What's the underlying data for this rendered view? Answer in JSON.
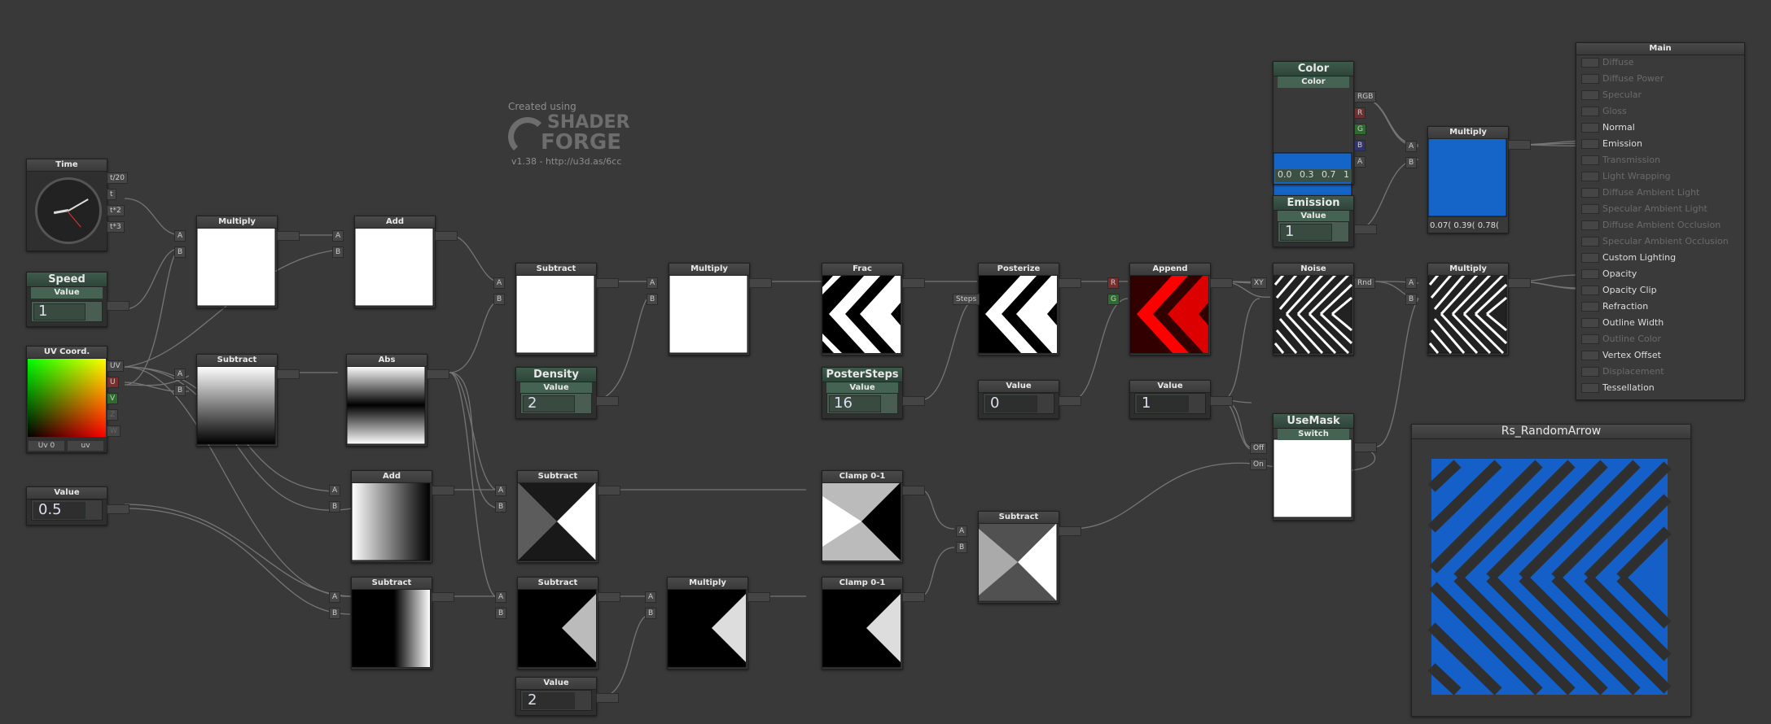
{
  "watermark": {
    "created": "Created using",
    "logo_line1": "SHADER",
    "logo_line2": "FORGE",
    "version": "v1.38 - http://u3d.as/6cc"
  },
  "nodes": {
    "time": {
      "title": "Time",
      "outs": [
        "t/20",
        "t",
        "t*2",
        "t*3"
      ]
    },
    "speed": {
      "title": "Speed",
      "sub": "Value",
      "value": "1"
    },
    "uv": {
      "title": "UV Coord.",
      "outs": [
        "UV",
        "U",
        "V",
        "Z",
        "W"
      ],
      "ch": "Uv 0",
      "mode": "uv"
    },
    "half": {
      "title": "Value",
      "value": "0.5"
    },
    "multiply1": {
      "title": "Multiply"
    },
    "add1": {
      "title": "Add"
    },
    "subtract1": {
      "title": "Subtract"
    },
    "abs": {
      "title": "Abs"
    },
    "subtract2": {
      "title": "Subtract"
    },
    "density": {
      "title": "Density",
      "sub": "Value",
      "value": "2"
    },
    "multiply2": {
      "title": "Multiply"
    },
    "frac": {
      "title": "Frac"
    },
    "postersteps": {
      "title": "PosterSteps",
      "sub": "Value",
      "value": "16"
    },
    "posterize": {
      "title": "Posterize",
      "steps": "Steps"
    },
    "value0": {
      "title": "Value",
      "value": "0"
    },
    "append": {
      "title": "Append",
      "r": "R",
      "g": "G"
    },
    "value1": {
      "title": "Value",
      "value": "1"
    },
    "noise": {
      "title": "Noise",
      "xy": "XY",
      "rnd": "Rnd"
    },
    "multiply3": {
      "title": "Multiply"
    },
    "add2": {
      "title": "Add"
    },
    "subtract3": {
      "title": "Subtract"
    },
    "clamp1": {
      "title": "Clamp 0-1"
    },
    "subtract4": {
      "title": "Subtract"
    },
    "subtract5": {
      "title": "Subtract"
    },
    "multiply4": {
      "title": "Multiply"
    },
    "clamp2": {
      "title": "Clamp 0-1"
    },
    "value2": {
      "title": "Value",
      "value": "2"
    },
    "subtract6": {
      "title": "Subtract"
    },
    "color": {
      "title": "Color",
      "sub": "Color",
      "outs": [
        "RGB",
        "R",
        "G",
        "B",
        "A"
      ],
      "vals": [
        "0.0",
        "0.3",
        "0.7",
        "1"
      ],
      "swatch": "#1565c8"
    },
    "emission": {
      "title": "Emission",
      "sub": "Value",
      "value": "1"
    },
    "multiply5": {
      "title": "Multiply",
      "vals": "0.07( 0.39( 0.78("
    },
    "usemask": {
      "title": "UseMask",
      "sub": "Switch",
      "off": "Off",
      "on": "On"
    },
    "preview": {
      "title": "Rs_RandomArrow",
      "bg": "#1460c8"
    }
  },
  "ports": {
    "a": "A",
    "b": "B"
  },
  "main": {
    "title": "Main",
    "inputs": [
      {
        "label": "Diffuse",
        "on": false
      },
      {
        "label": "Diffuse Power",
        "on": false
      },
      {
        "label": "Specular",
        "on": false
      },
      {
        "label": "Gloss",
        "on": false
      },
      {
        "label": "Normal",
        "on": true
      },
      {
        "label": "Emission",
        "on": true
      },
      {
        "label": "Transmission",
        "on": false
      },
      {
        "label": "Light Wrapping",
        "on": false
      },
      {
        "label": "Diffuse Ambient Light",
        "on": false
      },
      {
        "label": "Specular Ambient Light",
        "on": false
      },
      {
        "label": "Diffuse Ambient Occlusion",
        "on": false
      },
      {
        "label": "Specular Ambient Occlusion",
        "on": false
      },
      {
        "label": "Custom Lighting",
        "on": true
      },
      {
        "label": "Opacity",
        "on": true
      },
      {
        "label": "Opacity Clip",
        "on": true
      },
      {
        "label": "Refraction",
        "on": true
      },
      {
        "label": "Outline Width",
        "on": true
      },
      {
        "label": "Outline Color",
        "on": false
      },
      {
        "label": "Vertex Offset",
        "on": true
      },
      {
        "label": "Displacement",
        "on": false
      },
      {
        "label": "Tessellation",
        "on": true
      }
    ]
  }
}
